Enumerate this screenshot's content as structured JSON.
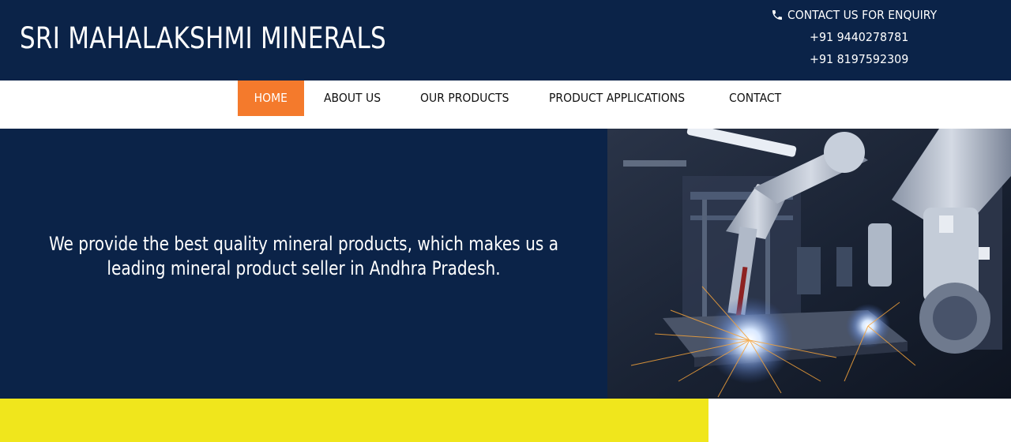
{
  "header": {
    "brand": "SRI MAHALAKSHMI MINERALS",
    "contact_heading": "CONTACT US FOR ENQUIRY",
    "phones": [
      "+91 9440278781",
      "+91 8197592309"
    ],
    "icon": "phone-icon"
  },
  "nav": {
    "items": [
      "HOME",
      "ABOUT US",
      "OUR PRODUCTS",
      "PRODUCT APPLICATIONS",
      "CONTACT"
    ],
    "active": "HOME"
  },
  "hero": {
    "tagline": "We provide the best quality mineral products, which makes us a leading mineral product seller in Andhra Pradesh."
  },
  "colors": {
    "navy": "#0b2348",
    "accent_orange": "#f47a2c",
    "band_yellow": "#f0e61c"
  }
}
